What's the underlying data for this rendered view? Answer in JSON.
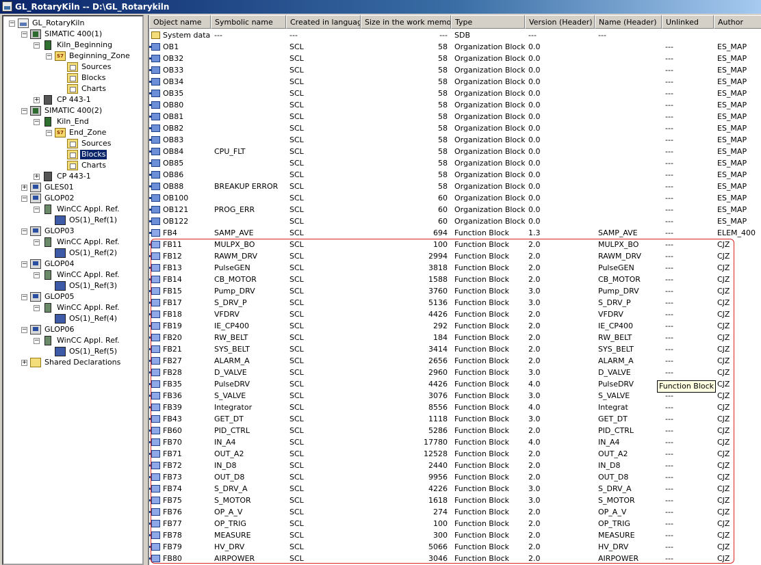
{
  "window": {
    "title": "GL_RotaryKiln -- D:\\GL_Rotarykiln"
  },
  "tree": [
    {
      "label": "GL_RotaryKiln",
      "icon": "project-icon",
      "level": 0,
      "expander": "-"
    },
    {
      "label": "SIMATIC 400(1)",
      "icon": "simatic-station-icon",
      "level": 1,
      "expander": "-"
    },
    {
      "label": "Kiln_Beginning",
      "icon": "cpu-icon",
      "level": 2,
      "expander": "-"
    },
    {
      "label": "Beginning_Zone",
      "icon": "s7-program-icon",
      "level": 3,
      "expander": "-"
    },
    {
      "label": "Sources",
      "icon": "sources-folder-icon",
      "level": 4,
      "expander": ""
    },
    {
      "label": "Blocks",
      "icon": "blocks-folder-icon",
      "level": 4,
      "expander": ""
    },
    {
      "label": "Charts",
      "icon": "charts-folder-icon",
      "level": 4,
      "expander": ""
    },
    {
      "label": "CP 443-1",
      "icon": "cp-module-icon",
      "level": 2,
      "expander": "+"
    },
    {
      "label": "SIMATIC 400(2)",
      "icon": "simatic-station-icon",
      "level": 1,
      "expander": "-"
    },
    {
      "label": "Kiln_End",
      "icon": "cpu-icon",
      "level": 2,
      "expander": "-"
    },
    {
      "label": "End_Zone",
      "icon": "s7-program-icon",
      "level": 3,
      "expander": "-"
    },
    {
      "label": "Sources",
      "icon": "sources-folder-icon",
      "level": 4,
      "expander": ""
    },
    {
      "label": "Blocks",
      "icon": "blocks-folder-icon",
      "level": 4,
      "expander": "",
      "selected": true
    },
    {
      "label": "Charts",
      "icon": "charts-folder-icon",
      "level": 4,
      "expander": ""
    },
    {
      "label": "CP 443-1",
      "icon": "cp-module-icon",
      "level": 2,
      "expander": "+"
    },
    {
      "label": "GLES01",
      "icon": "pc-station-icon",
      "level": 1,
      "expander": "+"
    },
    {
      "label": "GLOP02",
      "icon": "pc-station-icon",
      "level": 1,
      "expander": "-"
    },
    {
      "label": "WinCC Appl. Ref.",
      "icon": "wincc-application-icon",
      "level": 2,
      "expander": "-"
    },
    {
      "label": "OS(1)_Ref(1)",
      "icon": "os-reference-icon",
      "level": 3,
      "expander": ""
    },
    {
      "label": "GLOP03",
      "icon": "pc-station-icon",
      "level": 1,
      "expander": "-"
    },
    {
      "label": "WinCC Appl. Ref.",
      "icon": "wincc-application-icon",
      "level": 2,
      "expander": "-"
    },
    {
      "label": "OS(1)_Ref(2)",
      "icon": "os-reference-icon",
      "level": 3,
      "expander": ""
    },
    {
      "label": "GLOP04",
      "icon": "pc-station-icon",
      "level": 1,
      "expander": "-"
    },
    {
      "label": "WinCC Appl. Ref.",
      "icon": "wincc-application-icon",
      "level": 2,
      "expander": "-"
    },
    {
      "label": "OS(1)_Ref(3)",
      "icon": "os-reference-icon",
      "level": 3,
      "expander": ""
    },
    {
      "label": "GLOP05",
      "icon": "pc-station-icon",
      "level": 1,
      "expander": "-"
    },
    {
      "label": "WinCC Appl. Ref.",
      "icon": "wincc-application-icon",
      "level": 2,
      "expander": "-"
    },
    {
      "label": "OS(1)_Ref(4)",
      "icon": "os-reference-icon",
      "level": 3,
      "expander": ""
    },
    {
      "label": "GLOP06",
      "icon": "pc-station-icon",
      "level": 1,
      "expander": "-"
    },
    {
      "label": "WinCC Appl. Ref.",
      "icon": "wincc-application-icon",
      "level": 2,
      "expander": "-"
    },
    {
      "label": "OS(1)_Ref(5)",
      "icon": "os-reference-icon",
      "level": 3,
      "expander": ""
    },
    {
      "label": "Shared Declarations",
      "icon": "shared-declarations-folder-icon",
      "level": 1,
      "expander": "+"
    }
  ],
  "list": {
    "columns": [
      "Object name",
      "Symbolic name",
      "Created in language",
      "Size in the work memory",
      "Type",
      "Version (Header)",
      "Name (Header)",
      "Unlinked",
      "Author"
    ],
    "rows": [
      {
        "icon": "sdb",
        "name": "System data",
        "symbolic": "---",
        "lang": "---",
        "size": "---",
        "type": "SDB",
        "version": "---",
        "header_name": "---",
        "unlinked": "",
        "author": ""
      },
      {
        "icon": "ob",
        "name": "OB1",
        "symbolic": "",
        "lang": "SCL",
        "size": "58",
        "type": "Organization Block",
        "version": "0.0",
        "header_name": "",
        "unlinked": "---",
        "author": "ES_MAP"
      },
      {
        "icon": "ob",
        "name": "OB32",
        "symbolic": "",
        "lang": "SCL",
        "size": "58",
        "type": "Organization Block",
        "version": "0.0",
        "header_name": "",
        "unlinked": "---",
        "author": "ES_MAP"
      },
      {
        "icon": "ob",
        "name": "OB33",
        "symbolic": "",
        "lang": "SCL",
        "size": "58",
        "type": "Organization Block",
        "version": "0.0",
        "header_name": "",
        "unlinked": "---",
        "author": "ES_MAP"
      },
      {
        "icon": "ob",
        "name": "OB34",
        "symbolic": "",
        "lang": "SCL",
        "size": "58",
        "type": "Organization Block",
        "version": "0.0",
        "header_name": "",
        "unlinked": "---",
        "author": "ES_MAP"
      },
      {
        "icon": "ob",
        "name": "OB35",
        "symbolic": "",
        "lang": "SCL",
        "size": "58",
        "type": "Organization Block",
        "version": "0.0",
        "header_name": "",
        "unlinked": "---",
        "author": "ES_MAP"
      },
      {
        "icon": "ob",
        "name": "OB80",
        "symbolic": "",
        "lang": "SCL",
        "size": "58",
        "type": "Organization Block",
        "version": "0.0",
        "header_name": "",
        "unlinked": "---",
        "author": "ES_MAP"
      },
      {
        "icon": "ob",
        "name": "OB81",
        "symbolic": "",
        "lang": "SCL",
        "size": "58",
        "type": "Organization Block",
        "version": "0.0",
        "header_name": "",
        "unlinked": "---",
        "author": "ES_MAP"
      },
      {
        "icon": "ob",
        "name": "OB82",
        "symbolic": "",
        "lang": "SCL",
        "size": "58",
        "type": "Organization Block",
        "version": "0.0",
        "header_name": "",
        "unlinked": "---",
        "author": "ES_MAP"
      },
      {
        "icon": "ob",
        "name": "OB83",
        "symbolic": "",
        "lang": "SCL",
        "size": "58",
        "type": "Organization Block",
        "version": "0.0",
        "header_name": "",
        "unlinked": "---",
        "author": "ES_MAP"
      },
      {
        "icon": "ob",
        "name": "OB84",
        "symbolic": "CPU_FLT",
        "lang": "SCL",
        "size": "58",
        "type": "Organization Block",
        "version": "0.0",
        "header_name": "",
        "unlinked": "---",
        "author": "ES_MAP"
      },
      {
        "icon": "ob",
        "name": "OB85",
        "symbolic": "",
        "lang": "SCL",
        "size": "58",
        "type": "Organization Block",
        "version": "0.0",
        "header_name": "",
        "unlinked": "---",
        "author": "ES_MAP"
      },
      {
        "icon": "ob",
        "name": "OB86",
        "symbolic": "",
        "lang": "SCL",
        "size": "58",
        "type": "Organization Block",
        "version": "0.0",
        "header_name": "",
        "unlinked": "---",
        "author": "ES_MAP"
      },
      {
        "icon": "ob",
        "name": "OB88",
        "symbolic": "BREAKUP ERROR",
        "lang": "SCL",
        "size": "58",
        "type": "Organization Block",
        "version": "0.0",
        "header_name": "",
        "unlinked": "---",
        "author": "ES_MAP"
      },
      {
        "icon": "ob",
        "name": "OB100",
        "symbolic": "",
        "lang": "SCL",
        "size": "60",
        "type": "Organization Block",
        "version": "0.0",
        "header_name": "",
        "unlinked": "---",
        "author": "ES_MAP"
      },
      {
        "icon": "ob",
        "name": "OB121",
        "symbolic": "PROG_ERR",
        "lang": "SCL",
        "size": "60",
        "type": "Organization Block",
        "version": "0.0",
        "header_name": "",
        "unlinked": "---",
        "author": "ES_MAP"
      },
      {
        "icon": "ob",
        "name": "OB122",
        "symbolic": "",
        "lang": "SCL",
        "size": "60",
        "type": "Organization Block",
        "version": "0.0",
        "header_name": "",
        "unlinked": "---",
        "author": "ES_MAP"
      },
      {
        "icon": "fb",
        "name": "FB4",
        "symbolic": "SAMP_AVE",
        "lang": "SCL",
        "size": "694",
        "type": "Function Block",
        "version": "1.3",
        "header_name": "SAMP_AVE",
        "unlinked": "---",
        "author": "ELEM_400"
      },
      {
        "icon": "fb",
        "name": "FB11",
        "symbolic": "MULPX_BO",
        "lang": "SCL",
        "size": "100",
        "type": "Function Block",
        "version": "2.0",
        "header_name": "MULPX_BO",
        "unlinked": "---",
        "author": "CJZ"
      },
      {
        "icon": "fb",
        "name": "FB12",
        "symbolic": "RAWM_DRV",
        "lang": "SCL",
        "size": "2994",
        "type": "Function Block",
        "version": "2.0",
        "header_name": "RAWM_DRV",
        "unlinked": "---",
        "author": "CJZ"
      },
      {
        "icon": "fb",
        "name": "FB13",
        "symbolic": "PulseGEN",
        "lang": "SCL",
        "size": "3818",
        "type": "Function Block",
        "version": "2.0",
        "header_name": "PulseGEN",
        "unlinked": "---",
        "author": "CJZ"
      },
      {
        "icon": "fb",
        "name": "FB14",
        "symbolic": "CB_MOTOR",
        "lang": "SCL",
        "size": "1588",
        "type": "Function Block",
        "version": "2.0",
        "header_name": "CB_MOTOR",
        "unlinked": "---",
        "author": "CJZ"
      },
      {
        "icon": "fb",
        "name": "FB15",
        "symbolic": "Pump_DRV",
        "lang": "SCL",
        "size": "3760",
        "type": "Function Block",
        "version": "3.0",
        "header_name": "Pump_DRV",
        "unlinked": "---",
        "author": "CJZ"
      },
      {
        "icon": "fb",
        "name": "FB17",
        "symbolic": "S_DRV_P",
        "lang": "SCL",
        "size": "5136",
        "type": "Function Block",
        "version": "3.0",
        "header_name": "S_DRV_P",
        "unlinked": "---",
        "author": "CJZ"
      },
      {
        "icon": "fb",
        "name": "FB18",
        "symbolic": "VFDRV",
        "lang": "SCL",
        "size": "4426",
        "type": "Function Block",
        "version": "2.0",
        "header_name": "VFDRV",
        "unlinked": "---",
        "author": "CJZ"
      },
      {
        "icon": "fb",
        "name": "FB19",
        "symbolic": "IE_CP400",
        "lang": "SCL",
        "size": "292",
        "type": "Function Block",
        "version": "2.0",
        "header_name": "IE_CP400",
        "unlinked": "---",
        "author": "CJZ"
      },
      {
        "icon": "fb",
        "name": "FB20",
        "symbolic": "RW_BELT",
        "lang": "SCL",
        "size": "184",
        "type": "Function Block",
        "version": "2.0",
        "header_name": "RW_BELT",
        "unlinked": "---",
        "author": "CJZ"
      },
      {
        "icon": "fb",
        "name": "FB21",
        "symbolic": "SYS_BELT",
        "lang": "SCL",
        "size": "3414",
        "type": "Function Block",
        "version": "2.0",
        "header_name": "SYS_BELT",
        "unlinked": "---",
        "author": "CJZ"
      },
      {
        "icon": "fb",
        "name": "FB27",
        "symbolic": "ALARM_A",
        "lang": "SCL",
        "size": "2656",
        "type": "Function Block",
        "version": "2.0",
        "header_name": "ALARM_A",
        "unlinked": "---",
        "author": "CJZ"
      },
      {
        "icon": "fb",
        "name": "FB28",
        "symbolic": "D_VALVE",
        "lang": "SCL",
        "size": "2960",
        "type": "Function Block",
        "version": "3.0",
        "header_name": "D_VALVE",
        "unlinked": "---",
        "author": "CJZ"
      },
      {
        "icon": "fb",
        "name": "FB35",
        "symbolic": "PulseDRV",
        "lang": "SCL",
        "size": "4426",
        "type": "Function Block",
        "version": "4.0",
        "header_name": "PulseDRV",
        "unlinked": "",
        "author": "CJZ"
      },
      {
        "icon": "fb",
        "name": "FB36",
        "symbolic": "S_VALVE",
        "lang": "SCL",
        "size": "3076",
        "type": "Function Block",
        "version": "3.0",
        "header_name": "S_VALVE",
        "unlinked": "---",
        "author": "CJZ"
      },
      {
        "icon": "fb",
        "name": "FB39",
        "symbolic": "Integrator",
        "lang": "SCL",
        "size": "8556",
        "type": "Function Block",
        "version": "4.0",
        "header_name": "Integrat",
        "unlinked": "---",
        "author": "CJZ"
      },
      {
        "icon": "fb",
        "name": "FB43",
        "symbolic": "GET_DT",
        "lang": "SCL",
        "size": "1118",
        "type": "Function Block",
        "version": "3.0",
        "header_name": "GET_DT",
        "unlinked": "---",
        "author": "CJZ"
      },
      {
        "icon": "fb",
        "name": "FB60",
        "symbolic": "PID_CTRL",
        "lang": "SCL",
        "size": "5286",
        "type": "Function Block",
        "version": "2.0",
        "header_name": "PID_CTRL",
        "unlinked": "---",
        "author": "CJZ"
      },
      {
        "icon": "fb",
        "name": "FB70",
        "symbolic": "IN_A4",
        "lang": "SCL",
        "size": "17780",
        "type": "Function Block",
        "version": "4.0",
        "header_name": "IN_A4",
        "unlinked": "---",
        "author": "CJZ"
      },
      {
        "icon": "fb",
        "name": "FB71",
        "symbolic": "OUT_A2",
        "lang": "SCL",
        "size": "12528",
        "type": "Function Block",
        "version": "2.0",
        "header_name": "OUT_A2",
        "unlinked": "---",
        "author": "CJZ"
      },
      {
        "icon": "fb",
        "name": "FB72",
        "symbolic": "IN_D8",
        "lang": "SCL",
        "size": "2440",
        "type": "Function Block",
        "version": "2.0",
        "header_name": "IN_D8",
        "unlinked": "---",
        "author": "CJZ"
      },
      {
        "icon": "fb",
        "name": "FB73",
        "symbolic": "OUT_D8",
        "lang": "SCL",
        "size": "9956",
        "type": "Function Block",
        "version": "2.0",
        "header_name": "OUT_D8",
        "unlinked": "---",
        "author": "CJZ"
      },
      {
        "icon": "fb",
        "name": "FB74",
        "symbolic": "S_DRV_A",
        "lang": "SCL",
        "size": "4226",
        "type": "Function Block",
        "version": "3.0",
        "header_name": "S_DRV_A",
        "unlinked": "---",
        "author": "CJZ"
      },
      {
        "icon": "fb",
        "name": "FB75",
        "symbolic": "S_MOTOR",
        "lang": "SCL",
        "size": "1618",
        "type": "Function Block",
        "version": "3.0",
        "header_name": "S_MOTOR",
        "unlinked": "---",
        "author": "CJZ"
      },
      {
        "icon": "fb",
        "name": "FB76",
        "symbolic": "OP_A_V",
        "lang": "SCL",
        "size": "274",
        "type": "Function Block",
        "version": "2.0",
        "header_name": "OP_A_V",
        "unlinked": "---",
        "author": "CJZ"
      },
      {
        "icon": "fb",
        "name": "FB77",
        "symbolic": "OP_TRIG",
        "lang": "SCL",
        "size": "100",
        "type": "Function Block",
        "version": "2.0",
        "header_name": "OP_TRIG",
        "unlinked": "---",
        "author": "CJZ"
      },
      {
        "icon": "fb",
        "name": "FB78",
        "symbolic": "MEASURE",
        "lang": "SCL",
        "size": "300",
        "type": "Function Block",
        "version": "2.0",
        "header_name": "MEASURE",
        "unlinked": "---",
        "author": "CJZ"
      },
      {
        "icon": "fb",
        "name": "FB79",
        "symbolic": "HV_DRV",
        "lang": "SCL",
        "size": "5066",
        "type": "Function Block",
        "version": "2.0",
        "header_name": "HV_DRV",
        "unlinked": "---",
        "author": "CJZ"
      },
      {
        "icon": "fb",
        "name": "FB80",
        "symbolic": "AIRPOWER",
        "lang": "SCL",
        "size": "3046",
        "type": "Function Block",
        "version": "2.0",
        "header_name": "AIRPOWER",
        "unlinked": "---",
        "author": "CJZ"
      }
    ]
  },
  "tooltip": {
    "text": "Function Block"
  },
  "colors": {
    "selection": "#0a246a",
    "highlight_border": "#dd2222",
    "tooltip_bg": "#ffffe1"
  }
}
